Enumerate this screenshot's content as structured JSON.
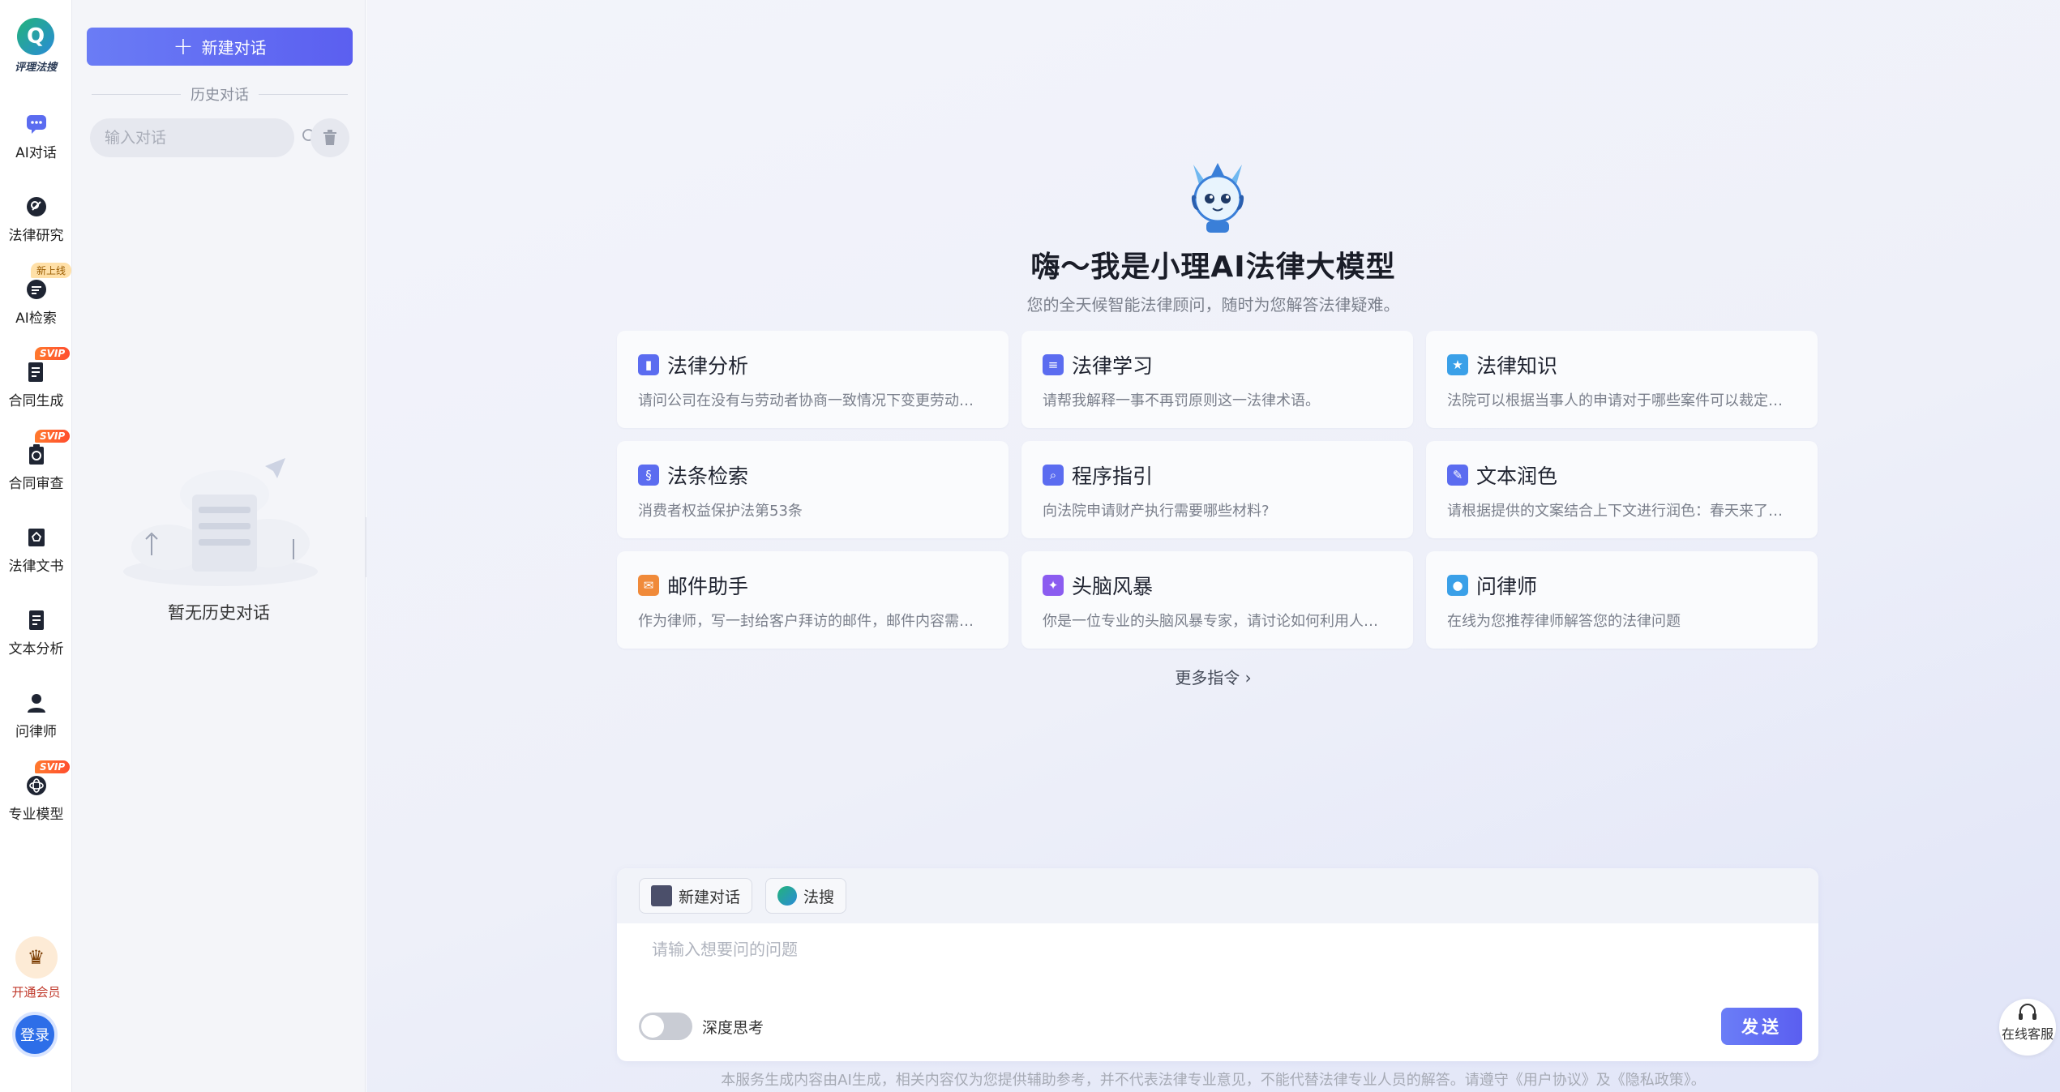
{
  "brand": {
    "logo_text": "评理法搜"
  },
  "rail": {
    "items": [
      {
        "label": "AI对话",
        "icon": "chat-bubble-icon",
        "active": true
      },
      {
        "label": "法律研究",
        "icon": "search-document-icon"
      },
      {
        "label": "AI检索",
        "icon": "ai-search-icon",
        "badge": "新上线"
      },
      {
        "label": "合同生成",
        "icon": "contract-write-icon",
        "badge": "SVIP"
      },
      {
        "label": "合同审查",
        "icon": "contract-review-icon",
        "badge": "SVIP"
      },
      {
        "label": "法律文书",
        "icon": "legal-document-icon"
      },
      {
        "label": "文本分析",
        "icon": "text-analysis-icon"
      },
      {
        "label": "问律师",
        "icon": "lawyer-icon"
      },
      {
        "label": "专业模型",
        "icon": "model-icon",
        "badge": "SVIP"
      }
    ],
    "vip_label": "开通会员",
    "login_label": "登录"
  },
  "history": {
    "new_chat_label": "新建对话",
    "section_label": "历史对话",
    "search_placeholder": "输入对话",
    "empty_text": "暂无历史对话"
  },
  "hero": {
    "title": "嗨～我是小理AI法律大模型",
    "subtitle": "您的全天候智能法律顾问，随时为您解答法律疑难。"
  },
  "cards": [
    {
      "title": "法律分析",
      "desc": "请问公司在没有与劳动者协商一致情况下变更劳动合同可以吗？",
      "icon": "book-icon",
      "color": "#5b6cf0"
    },
    {
      "title": "法律学习",
      "desc": "请帮我解释一事不再罚原则这一法律术语。",
      "icon": "open-book-icon",
      "color": "#5b6cf0"
    },
    {
      "title": "法律知识",
      "desc": "法院可以根据当事人的申请对于哪些案件可以裁定先予执行？",
      "icon": "knowledge-icon",
      "color": "#3aa0e8"
    },
    {
      "title": "法条检索",
      "desc": "消费者权益保护法第53条",
      "icon": "statute-icon",
      "color": "#5b6cf0"
    },
    {
      "title": "程序指引",
      "desc": "向法院申请财产执行需要哪些材料?",
      "icon": "guide-icon",
      "color": "#5b6cf0"
    },
    {
      "title": "文本润色",
      "desc": "请根据提供的文案结合上下文进行润色：春天来了，万物复苏。",
      "icon": "pen-icon",
      "color": "#5b6cf0"
    },
    {
      "title": "邮件助手",
      "desc": "作为律师，写一封给客户拜访的邮件，邮件内容需要包含拜访时间。",
      "icon": "mail-icon",
      "color": "#f08a3a"
    },
    {
      "title": "头脑风暴",
      "desc": "你是一位专业的头脑风暴专家，请讨论如何利用人工智能提升法律服务。",
      "icon": "brain-icon",
      "color": "#8b5cf0"
    },
    {
      "title": "问律师",
      "desc": "在线为您推荐律师解答您的法律问题",
      "icon": "lawyer-card-icon",
      "color": "#3aa0e8"
    }
  ],
  "more_commands": "更多指令",
  "composer": {
    "chip_new_chat": "新建对话",
    "chip_fasou": "法搜",
    "placeholder": "请输入想要问的问题",
    "deep_think_label": "深度思考",
    "deep_think_on": false,
    "send_label": "发送"
  },
  "footnote": "本服务生成内容由AI生成，相关内容仅为您提供辅助参考，并不代表法律专业意见，不能代替法律专业人员的解答。请遵守《用户协议》及《隐私政策》。",
  "service_label": "在线客服"
}
